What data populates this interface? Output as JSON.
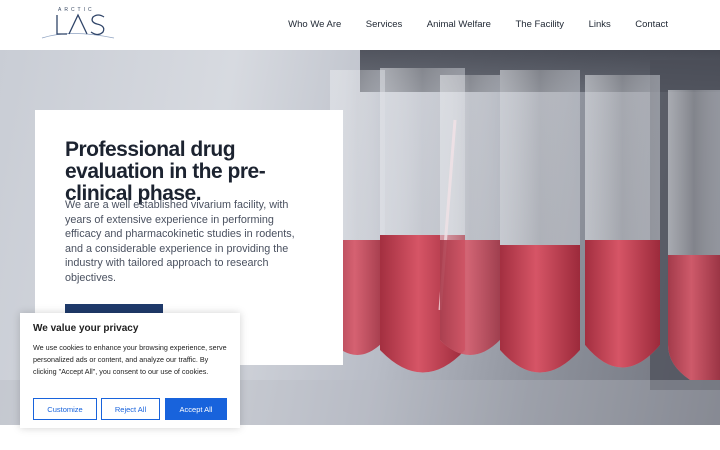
{
  "logo": {
    "small_text": "ARCTIC",
    "main_text": "LAS"
  },
  "nav": {
    "items": [
      {
        "label": "Who We Are"
      },
      {
        "label": "Services"
      },
      {
        "label": "Animal Welfare"
      },
      {
        "label": "The Facility"
      },
      {
        "label": "Links"
      },
      {
        "label": "Contact"
      }
    ]
  },
  "hero": {
    "title": "Professional drug evaluation in the pre-clinical phase.",
    "description": "We are a well established vivarium facility, with years of extensive experience in performing efficacy and pharmacokinetic studies in rodents, and a considerable experience in providing the industry with tailored approach to research objectives.",
    "button_label": ""
  },
  "cookie": {
    "title": "We value your privacy",
    "text": "We use cookies to enhance your browsing experience, serve personalized ads or content, and analyze our traffic. By clicking \"Accept All\", you consent to our use of cookies.",
    "customize_label": "Customize",
    "reject_label": "Reject All",
    "accept_label": "Accept All"
  },
  "colors": {
    "brand": "#1f3a6b",
    "cookie_accent": "#1863dc",
    "liquid": "#c4404f"
  }
}
